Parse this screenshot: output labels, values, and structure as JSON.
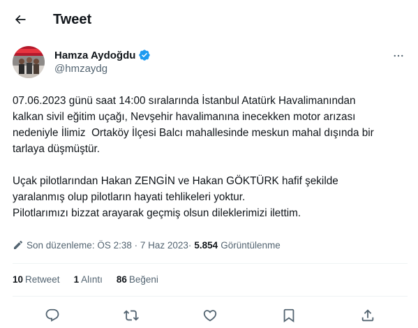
{
  "header": {
    "title": "Tweet",
    "back_icon": "arrow-left-icon"
  },
  "author": {
    "name": "Hamza Aydoğdu",
    "handle": "@hmzaydg",
    "verified": true,
    "verified_color": "#1d9bf0"
  },
  "tweet": {
    "paragraphs": [
      [
        "07.06.2023 günü saat 14:00 sıralarında İstanbul Atatürk Havalimanından",
        "kalkan sivil eğitim uçağı, Nevşehir havalimanına inecekken motor arızası",
        "nedeniyle İlimiz  Ortaköy İlçesi Balcı mahallesinde meskun mahal dışında bir",
        "tarlaya düşmüştür."
      ],
      [
        "Uçak pilotlarından Hakan ZENGİN ve Hakan GÖKTÜRK hafif şekilde",
        "yaralanmış olup pilotların hayati tehlikeleri yoktur.",
        "Pilotlarımızı bizzat arayarak geçmiş olsun dileklerimizi ilettim."
      ]
    ]
  },
  "meta": {
    "edited_label": "Son düzenleme: ÖS 2:38 · 7 Haz 2023",
    "separator": " · ",
    "views_count": "5.854",
    "views_label": "Görüntülenme"
  },
  "stats": [
    {
      "count": "10",
      "label": "Retweet"
    },
    {
      "count": "1",
      "label": "Alıntı"
    },
    {
      "count": "86",
      "label": "Beğeni"
    }
  ],
  "actions": [
    "reply-icon",
    "retweet-icon",
    "like-icon",
    "bookmark-icon",
    "share-icon"
  ],
  "colors": {
    "text": "#0f1419",
    "secondary": "#536471",
    "divider": "#eff3f4",
    "accent": "#1d9bf0"
  }
}
